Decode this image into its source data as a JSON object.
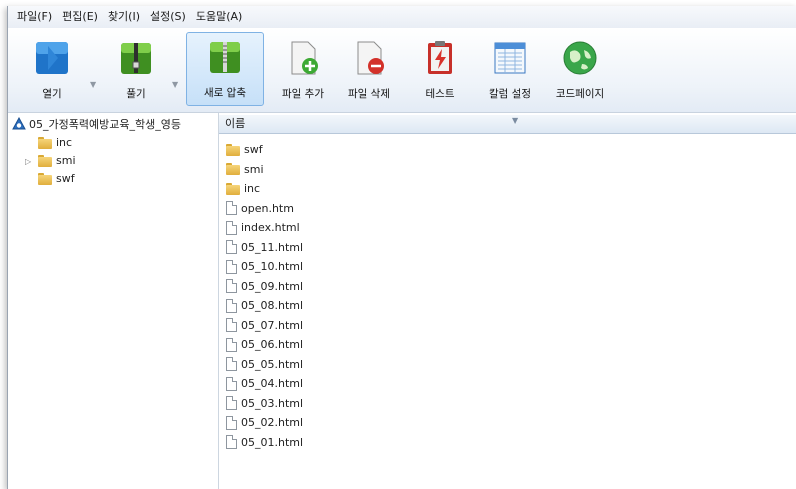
{
  "menu": [
    {
      "name": "menu-file",
      "label": "파일(F)"
    },
    {
      "name": "menu-edit",
      "label": "편집(E)"
    },
    {
      "name": "menu-find",
      "label": "찾기(I)"
    },
    {
      "name": "menu-settings",
      "label": "설정(S)"
    },
    {
      "name": "menu-help",
      "label": "도움말(A)"
    }
  ],
  "toolbar": {
    "open": "열기",
    "extract": "풀기",
    "new_archive": "새로 압축",
    "add_file": "파일 추가",
    "delete_file": "파일 삭제",
    "test": "테스트",
    "column_settings": "칼럼 설정",
    "codepage": "코드페이지"
  },
  "tree": {
    "root": "05_가정폭력예방교육_학생_영등",
    "children": [
      "inc",
      "smi",
      "swf"
    ]
  },
  "list": {
    "column_name": "이름",
    "folders": [
      "swf",
      "smi",
      "inc"
    ],
    "files": [
      "open.htm",
      "index.html",
      "05_11.html",
      "05_10.html",
      "05_09.html",
      "05_08.html",
      "05_07.html",
      "05_06.html",
      "05_05.html",
      "05_04.html",
      "05_03.html",
      "05_02.html",
      "05_01.html"
    ]
  },
  "colors": {
    "accent": "#7fb2e4",
    "folder": "#e0ae3d"
  }
}
